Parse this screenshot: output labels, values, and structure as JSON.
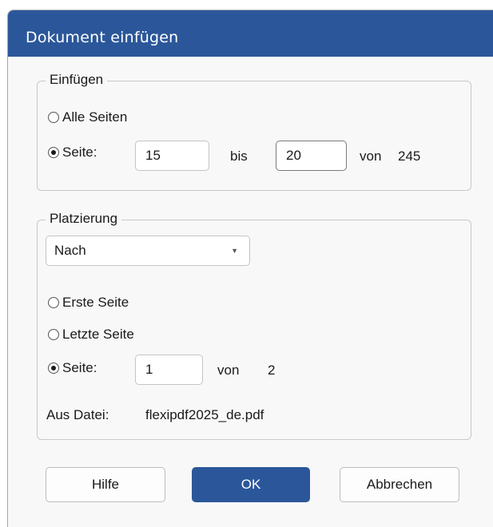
{
  "dialog": {
    "title": "Dokument einfügen"
  },
  "insert_group": {
    "legend": "Einfügen",
    "all_pages_label": "Alle Seiten",
    "page_label": "Seite:",
    "from_value": "15",
    "to_label": "bis",
    "to_value": "20",
    "of_label": "von",
    "total_pages": "245",
    "selected_option": "page"
  },
  "placement_group": {
    "legend": "Platzierung",
    "position_select": "Nach",
    "first_page_label": "Erste Seite",
    "last_page_label": "Letzte Seite",
    "page_label": "Seite:",
    "page_value": "1",
    "of_label": "von",
    "total_pages": "2",
    "selected_option": "page",
    "source_label": "Aus Datei:",
    "source_file": "flexipdf2025_de.pdf"
  },
  "buttons": {
    "help": "Hilfe",
    "ok": "OK",
    "cancel": "Abbrechen"
  },
  "colors": {
    "accent": "#2b579a",
    "dialog_bg": "#f8f8f8"
  }
}
